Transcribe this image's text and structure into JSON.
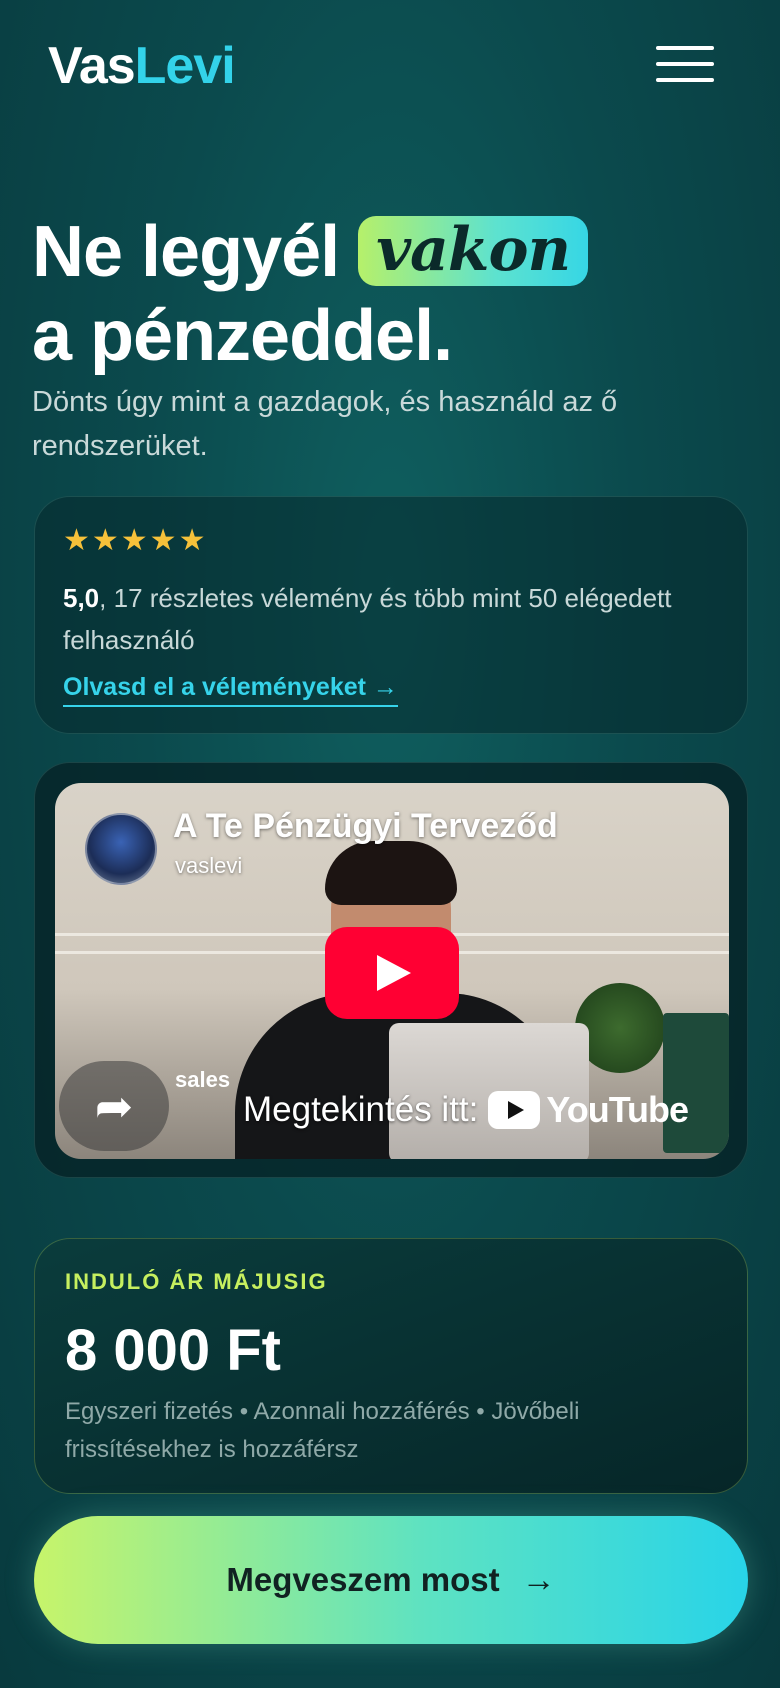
{
  "header": {
    "logo_part1": "Vas",
    "logo_part2": "Levi",
    "menu_icon": "hamburger-menu-icon"
  },
  "hero": {
    "title_before": "Ne legyél",
    "title_highlight": "vakon",
    "title_after": "a pénzeddel.",
    "subtitle": "Dönts úgy mint a gazdagok, és használd az ő rendszerüket."
  },
  "reviews": {
    "stars": "★★★★★",
    "rating": "5,0",
    "text": ", 17 részletes vélemény és több mint 50 elégedett felhasználó",
    "link_label": "Olvasd el a véleményeket →"
  },
  "video": {
    "title": "A Te Pénzügyi Terveződ",
    "channel": "vaslevi",
    "overlay_label": "sales",
    "watch_label": "Megtekintés itt:",
    "youtube_word": "YouTube",
    "share_icon": "share-arrow-icon"
  },
  "pricing": {
    "label": "INDULÓ ÁR MÁJUSIG",
    "price": "8 000 Ft",
    "note": "Egyszeri fizetés • Azonnali hozzáférés • Jövőbeli frissítésekhez is hozzáférsz"
  },
  "cta": {
    "label": "Megveszem most",
    "arrow": "→"
  },
  "colors": {
    "accent_cyan": "#33d3ea",
    "accent_lime": "#c6ef5f",
    "star": "#f6c13a",
    "youtube_red": "#ff0033"
  }
}
